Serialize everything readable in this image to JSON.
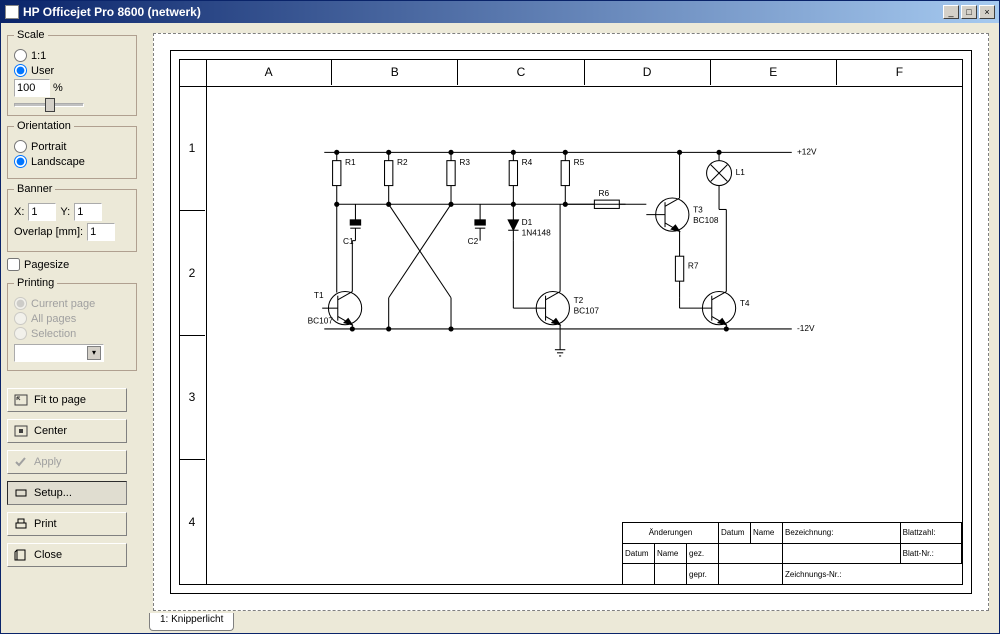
{
  "window": {
    "title": "HP Officejet Pro 8600 (netwerk)"
  },
  "help": "?",
  "sidebar": {
    "scale": {
      "legend": "Scale",
      "opt11": "1:1",
      "optUser": "User",
      "value": "100",
      "unit": "%",
      "selected": "user"
    },
    "orientation": {
      "legend": "Orientation",
      "portrait": "Portrait",
      "landscape": "Landscape",
      "selected": "landscape"
    },
    "banner": {
      "legend": "Banner",
      "xLabel": "X:",
      "yLabel": "Y:",
      "xValue": "1",
      "yValue": "1",
      "overlapLabel": "Overlap [mm]:",
      "overlapValue": "1"
    },
    "pagesize": "Pagesize",
    "printing": {
      "legend": "Printing",
      "current": "Current page",
      "all": "All pages",
      "selection": "Selection"
    },
    "buttons": {
      "fit": "Fit to page",
      "center": "Center",
      "apply": "Apply",
      "setup": "Setup...",
      "print": "Print",
      "close": "Close"
    }
  },
  "preview": {
    "columns": [
      "A",
      "B",
      "C",
      "D",
      "E",
      "F"
    ],
    "rows": [
      "1",
      "2",
      "3",
      "4"
    ],
    "titleBlock": {
      "header": "Änderungen",
      "datum": "Datum",
      "name": "Name",
      "bezeichnung": "Bezeichnung:",
      "blattzahl": "Blattzahl:",
      "blattnr": "Blatt-Nr.:",
      "zeichnungsnr": "Zeichnungs-Nr.:",
      "gez": "gez.",
      "gepr": "gepr."
    },
    "circuit": {
      "supplyTop": "+12V",
      "supplyBot": "-12V",
      "r1": "R1",
      "r2": "R2",
      "r3": "R3",
      "r4": "R4",
      "r5": "R5",
      "r6": "R6",
      "r7": "R7",
      "t1": "T1",
      "t2": "T2",
      "t3": "T3",
      "t4": "T4",
      "bc107": "BC107",
      "bc108": "BC108",
      "d1": "D1",
      "d1type": "1N4148",
      "c1": "C1",
      "c2": "C2",
      "l1": "L1"
    }
  },
  "tabs": {
    "tab1": "1: Knipperlicht"
  }
}
